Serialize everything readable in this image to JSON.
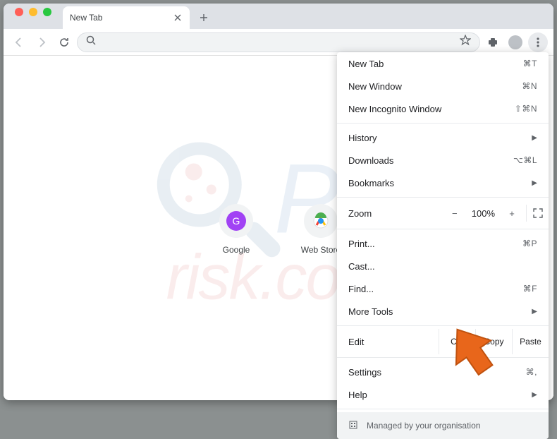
{
  "tab": {
    "title": "New Tab"
  },
  "shortcuts": [
    {
      "label": "Google",
      "letter": "G"
    },
    {
      "label": "Web Store"
    }
  ],
  "menu": {
    "new_tab": "New Tab",
    "new_tab_k": "⌘T",
    "new_window": "New Window",
    "new_window_k": "⌘N",
    "new_incognito": "New Incognito Window",
    "new_incognito_k": "⇧⌘N",
    "history": "History",
    "downloads": "Downloads",
    "downloads_k": "⌥⌘L",
    "bookmarks": "Bookmarks",
    "zoom": "Zoom",
    "zoom_val": "100%",
    "print": "Print...",
    "print_k": "⌘P",
    "cast": "Cast...",
    "find": "Find...",
    "find_k": "⌘F",
    "more_tools": "More Tools",
    "edit": "Edit",
    "cut": "Cut",
    "copy": "Copy",
    "paste": "Paste",
    "settings": "Settings",
    "settings_k": "⌘,",
    "help": "Help",
    "managed": "Managed by your organisation"
  },
  "watermark": {
    "pc": "PC",
    "risk": "risk.com"
  },
  "icons": {
    "plus": "+",
    "minus": "−",
    "zoom_plus": "+"
  }
}
